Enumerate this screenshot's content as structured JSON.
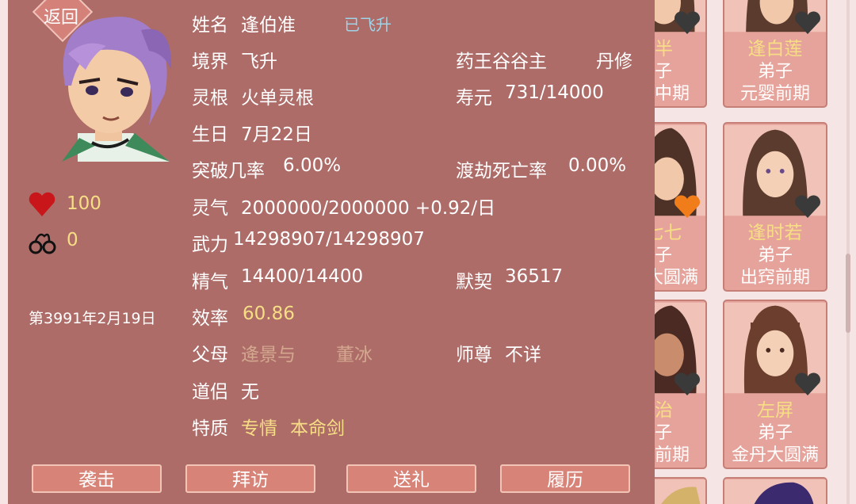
{
  "back_label": "返回",
  "character": {
    "name_label": "姓名",
    "name": "逢伯准",
    "ascended_badge": "已飞升",
    "realm_label": "境界",
    "realm": "飞升",
    "sect": "药王谷谷主",
    "profession": "丹修",
    "root_label": "灵根",
    "root": "火单灵根",
    "lifespan_label": "寿元",
    "lifespan": "731/14000",
    "birthday_label": "生日",
    "birthday": "7月22日",
    "breakthrough_label": "突破几率",
    "breakthrough": "6.00%",
    "tribulation_label": "渡劫死亡率",
    "tribulation": "0.00%",
    "qi_label": "灵气",
    "qi": "2000000/2000000 +0.92/日",
    "force_label": "武力",
    "force": "14298907/14298907",
    "essence_label": "精气",
    "essence": "14400/14400",
    "tacit_label": "默契",
    "tacit": "36517",
    "efficiency_label": "效率",
    "efficiency": "60.86",
    "parents_label": "父母",
    "father": "逄景与",
    "mother": "董冰",
    "master_label": "师尊",
    "master": "不详",
    "partner_label": "道侣",
    "partner": "无",
    "traits_label": "特质",
    "trait_1": "专情",
    "trait_2": "本命剑"
  },
  "stats": {
    "health": "100",
    "shackles": "0",
    "date": "第3991年2月19日"
  },
  "actions": [
    "袭击",
    "拜访",
    "送礼",
    "履历"
  ],
  "cards": [
    {
      "name": "逢半",
      "role": "弟子",
      "rank": "出窍中期",
      "heart": "#3a3a3a"
    },
    {
      "name": "逢白莲",
      "role": "弟子",
      "rank": "元婴前期",
      "heart": "#3a3a3a"
    },
    {
      "name": "逢七七",
      "role": "弟子",
      "rank": "化神大圆满",
      "heart": "#f07d1a"
    },
    {
      "name": "逢时若",
      "role": "弟子",
      "rank": "出窍前期",
      "heart": "#3a3a3a"
    },
    {
      "name": "逢治",
      "role": "弟子",
      "rank": "化神前期",
      "heart": "#3a3a3a"
    },
    {
      "name": "左屏",
      "role": "弟子",
      "rank": "金丹大圆满",
      "heart": "#3a3a3a"
    }
  ],
  "colors": {
    "panel": "#ad6c68",
    "gold": "#f7de85",
    "button": "#d88378",
    "badge": "#9fd3e8"
  }
}
